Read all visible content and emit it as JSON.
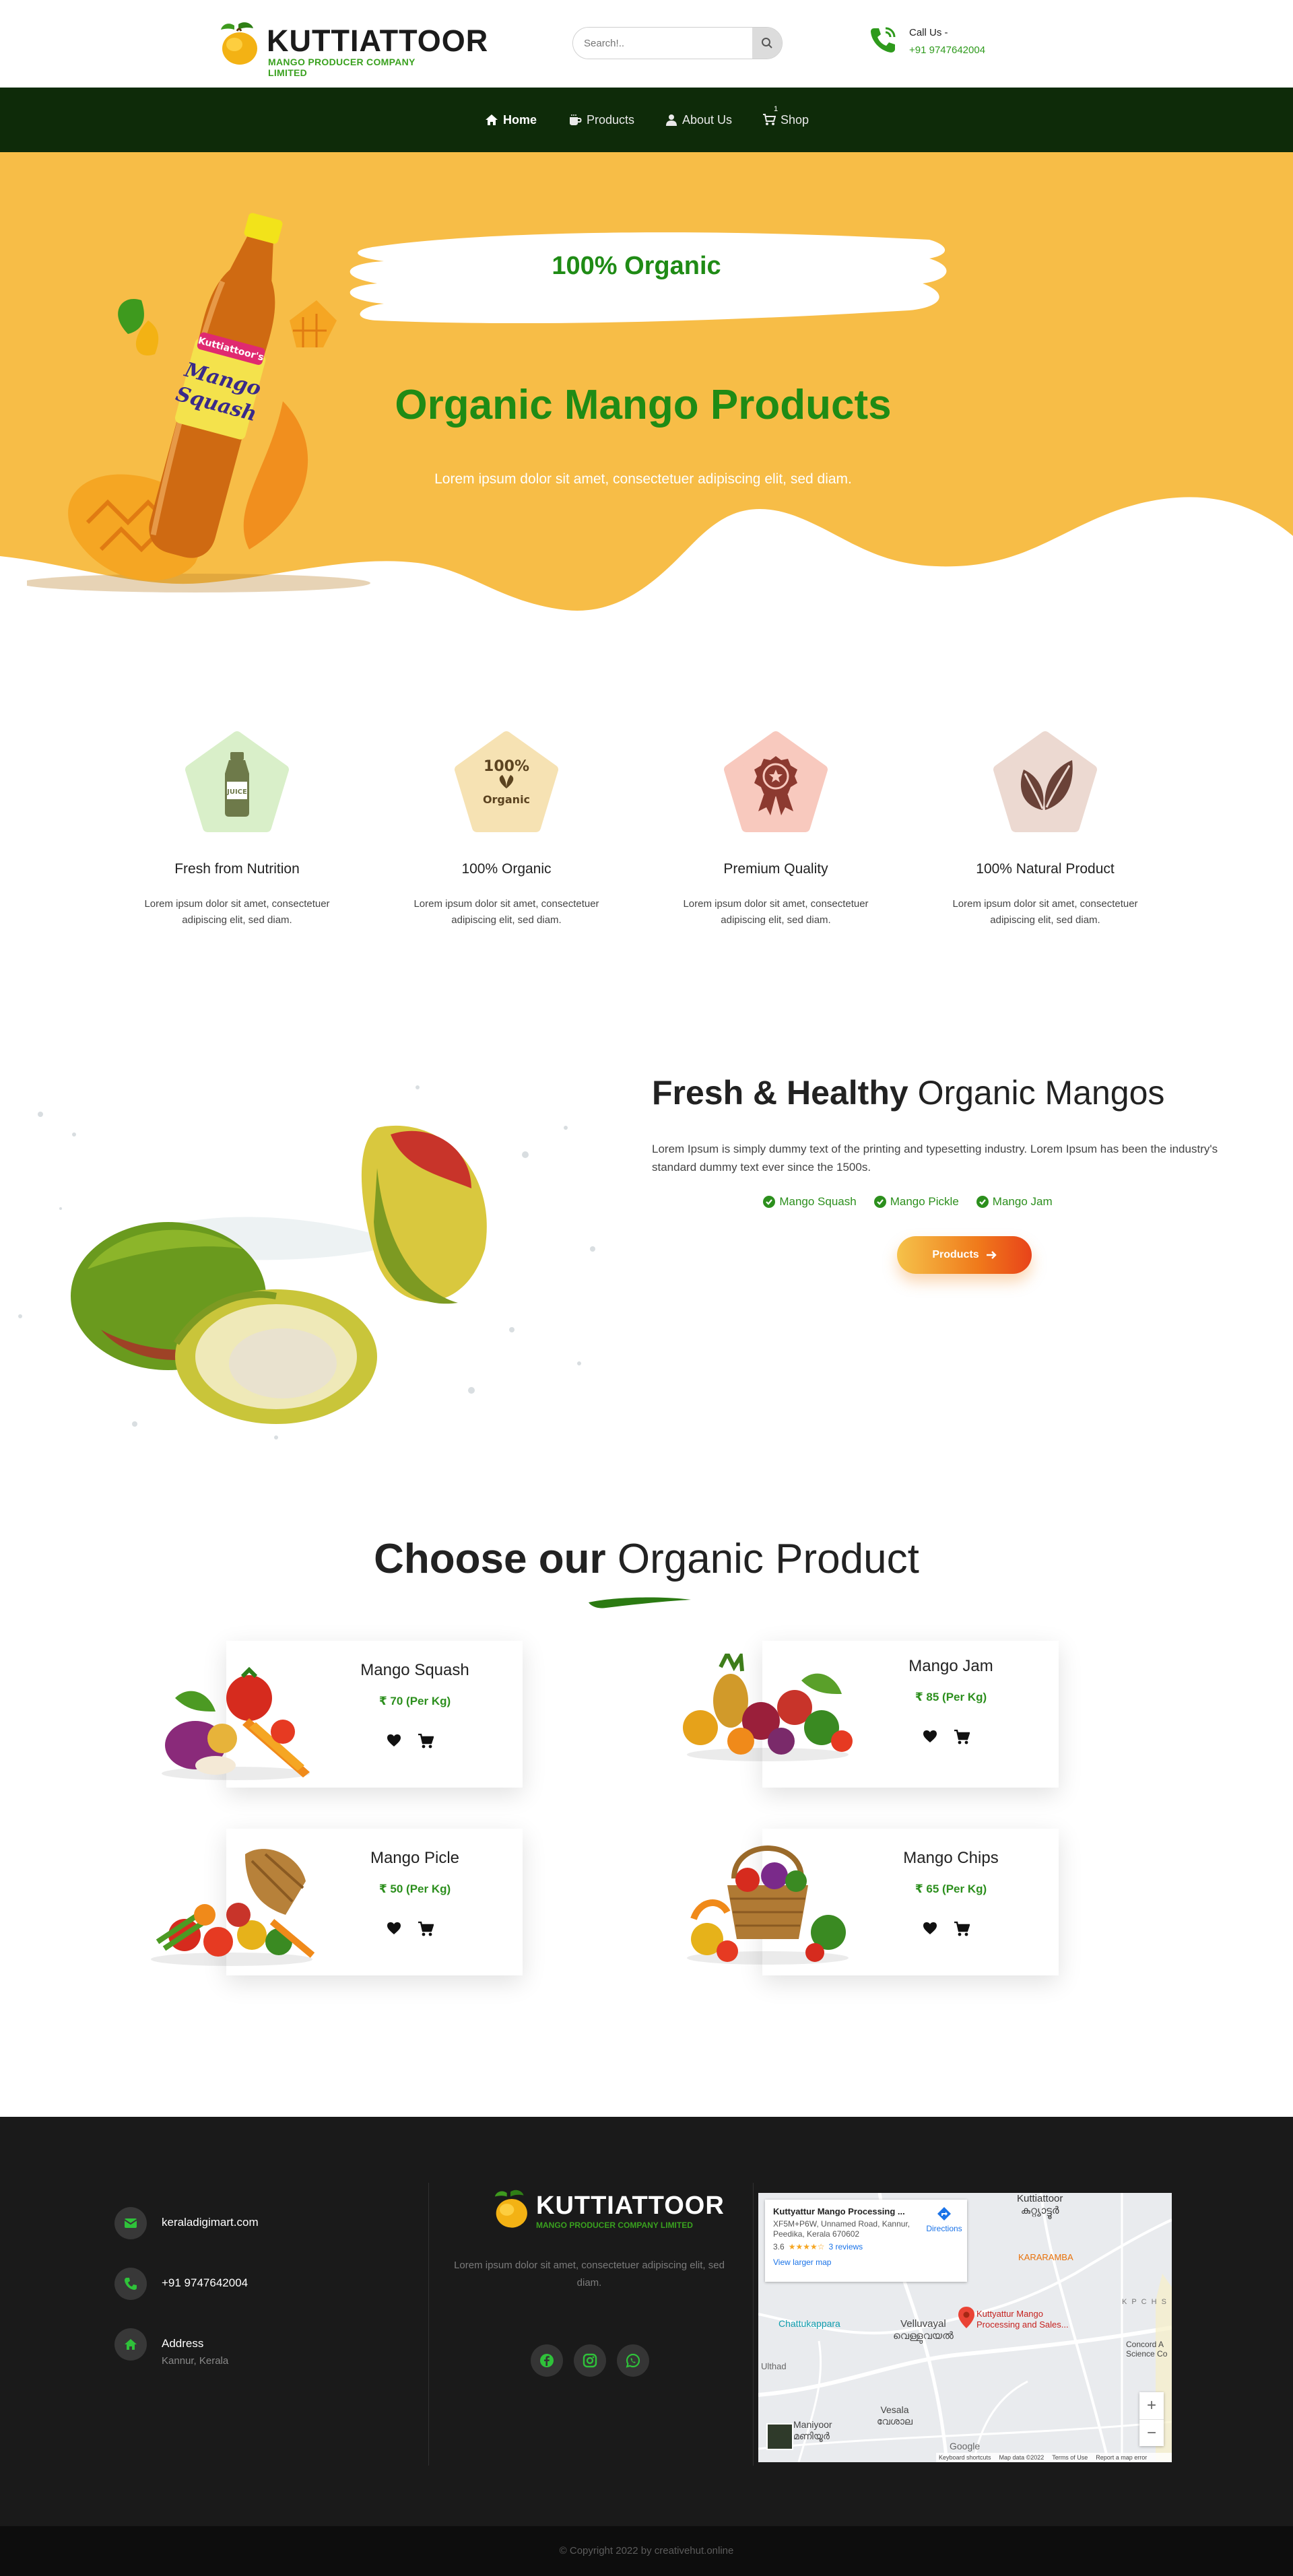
{
  "header": {
    "logo": {
      "title": "KUTTIATTOOR",
      "subtitle": "MANGO PRODUCER COMPANY LIMITED"
    },
    "search": {
      "placeholder": "Search!.."
    },
    "call": {
      "label": "Call Us -",
      "number": "+91 9747642004"
    }
  },
  "nav": {
    "items": [
      {
        "label": "Home",
        "icon": "home-icon",
        "active": true
      },
      {
        "label": "Products",
        "icon": "cup-icon"
      },
      {
        "label": "About Us",
        "icon": "user-icon"
      },
      {
        "label": "Shop",
        "icon": "cart-icon"
      }
    ],
    "cart_count": "1"
  },
  "hero": {
    "badge": "100% Organic",
    "title": "Organic Mango Products",
    "subtitle": "Lorem ipsum dolor sit amet, consectetuer adipiscing elit, sed diam.",
    "bottle_label": [
      "Kuttiattoor's",
      "Mango",
      "Squash"
    ],
    "colors": {
      "background": "#f7bd47",
      "accent": "#1f8b15"
    }
  },
  "features": [
    {
      "icon": "juice-bottle-icon",
      "icon_text": "JUICE",
      "title": "Fresh from Nutrition",
      "text": "Lorem ipsum dolor sit amet, consectetuer adipiscing elit, sed diam.",
      "bg": "#d9efc9"
    },
    {
      "icon": "organic-badge-icon",
      "icon_text": "100%",
      "icon_text2": "Organic",
      "title": "100% Organic",
      "text": "Lorem ipsum dolor sit amet, consectetuer adipiscing elit, sed diam.",
      "bg": "#f6e2b3"
    },
    {
      "icon": "award-ribbon-icon",
      "title": "Premium Quality",
      "text": "Lorem ipsum dolor sit amet, consectetuer adipiscing elit, sed diam.",
      "bg": "#f8c9be"
    },
    {
      "icon": "leaves-icon",
      "title": "100% Natural Product",
      "text": "Lorem ipsum dolor sit amet, consectetuer adipiscing elit, sed diam.",
      "bg": "#ecd9d1"
    }
  ],
  "fresh": {
    "title_bold": "Fresh & Healthy",
    "title_light": "Organic Mangos",
    "description": "Lorem Ipsum is simply dummy text of the printing and typesetting industry. Lorem Ipsum has been the industry's standard dummy text ever since the 1500s.",
    "checks": [
      "Mango Squash",
      "Mango Pickle",
      "Mango Jam"
    ],
    "button": "Products"
  },
  "choose": {
    "title_bold": "Choose our",
    "title_light": "Organic Product",
    "products": [
      {
        "name": "Mango Squash",
        "price": "₹ 70 (Per Kg)"
      },
      {
        "name": "Mango Jam",
        "price": "₹ 85 (Per Kg)"
      },
      {
        "name": "Mango Picle",
        "price": "₹ 50 (Per Kg)"
      },
      {
        "name": "Mango Chips",
        "price": "₹ 65 (Per Kg)"
      }
    ]
  },
  "footer": {
    "email": "keraladigimart.com",
    "phone": "+91 9747642004",
    "address_label": "Address",
    "address": "Kannur, Kerala",
    "logo": {
      "title": "KUTTIATTOOR",
      "subtitle": "MANGO PRODUCER COMPANY LIMITED"
    },
    "description": "Lorem ipsum dolor sit amet, consectetuer adipiscing elit, sed diam.",
    "social": [
      "facebook-icon",
      "instagram-icon",
      "whatsapp-icon"
    ],
    "map": {
      "place_name": "Kuttyattur Mango Processing ...",
      "address_line1": "XF5M+P6W, Unnamed Road, Kannur,",
      "address_line2": "Peedika, Kerala 670602",
      "rating": "3.6",
      "reviews": "3 reviews",
      "directions": "Directions",
      "larger_map": "View larger map",
      "labels": [
        "Kuttiattoor",
        "കുറ്റ്യാട്ടൂർ",
        "KARARAMBA",
        "Chattukappara",
        "Velluvayal",
        "വെള്ളുവയൽ",
        "Kuttyattur Mango",
        "Processing and Sales...",
        "Ulthad",
        "Maniyoor",
        "മണിയൂർ",
        "Vesala",
        "വേശാല",
        "K P C H S",
        "Concord A",
        "Science Co",
        "Google"
      ],
      "footer_links": [
        "Keyboard shortcuts",
        "Map data ©2022",
        "Terms of Use",
        "Report a map error"
      ]
    }
  },
  "copyright": "© Copyright 2022 by creativehut.online"
}
